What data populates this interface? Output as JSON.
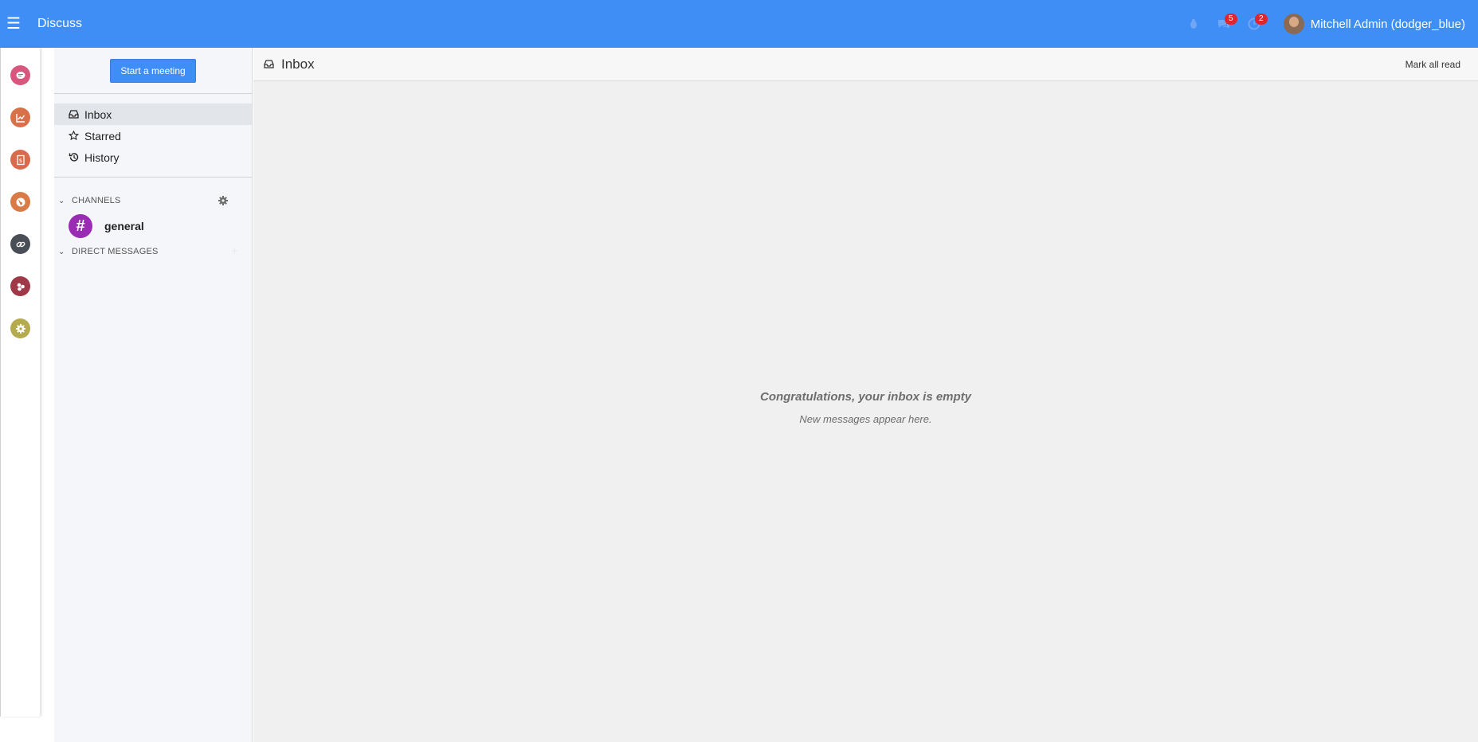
{
  "header": {
    "app_title": "Discuss",
    "chat_badge": "5",
    "activity_badge": "2",
    "user_name": "Mitchell Admin (dodger_blue)"
  },
  "rail": {
    "apps": [
      {
        "icon": "discuss-icon",
        "color": "#e05f86"
      },
      {
        "icon": "chart-icon",
        "color": "#e07a50"
      },
      {
        "icon": "invoice-icon",
        "color": "#e06b4e"
      },
      {
        "icon": "website-icon",
        "color": "#e0804c"
      },
      {
        "icon": "link-icon",
        "color": "#4b4f58"
      },
      {
        "icon": "apps-icon",
        "color": "#a83c4a"
      },
      {
        "icon": "settings-icon",
        "color": "#bcb256"
      }
    ]
  },
  "sidebar": {
    "start_meeting_label": "Start a meeting",
    "nav": [
      {
        "label": "Inbox",
        "icon": "inbox-icon"
      },
      {
        "label": "Starred",
        "icon": "star-icon"
      },
      {
        "label": "History",
        "icon": "history-icon"
      }
    ],
    "channels_label": "CHANNELS",
    "channels": [
      {
        "name": "general",
        "avatar": "#"
      }
    ],
    "direct_messages_label": "DIRECT MESSAGES"
  },
  "main": {
    "title": "Inbox",
    "mark_all_read_label": "Mark all read",
    "empty_title": "Congratulations, your inbox is empty",
    "empty_subtitle": "New messages appear here."
  }
}
